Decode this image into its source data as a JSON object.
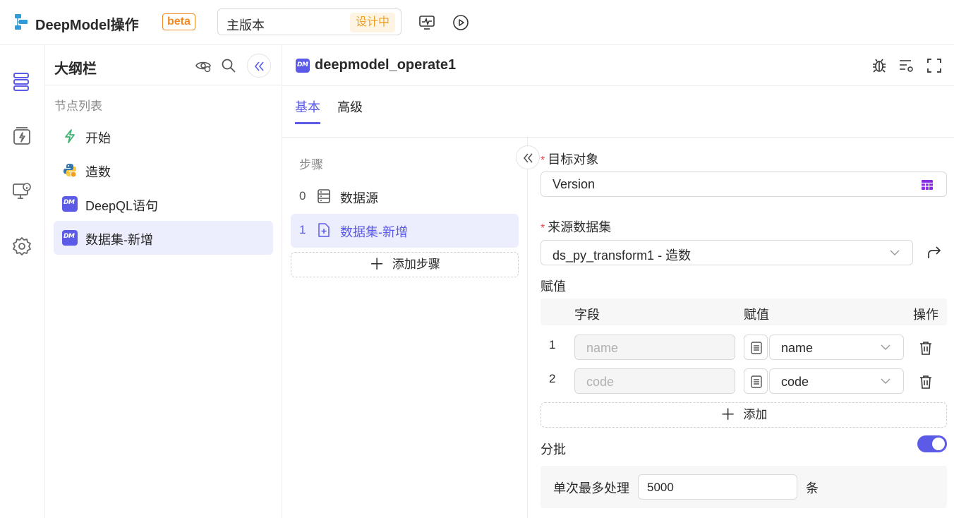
{
  "app": {
    "title": "DeepModel操作",
    "badge": "beta"
  },
  "version": {
    "name": "主版本",
    "status": "设计中"
  },
  "outline": {
    "title": "大纲栏",
    "section_label": "节点列表",
    "nodes": [
      {
        "label": "开始",
        "icon": "lightning-icon"
      },
      {
        "label": "造数",
        "icon": "python-icon"
      },
      {
        "label": "DeepQL语句",
        "icon": "dm-icon"
      },
      {
        "label": "数据集-新增",
        "icon": "dm-icon",
        "active": true
      }
    ]
  },
  "main": {
    "badge": "DM",
    "title": "deepmodel_operate1",
    "tabs": [
      {
        "label": "基本",
        "active": true
      },
      {
        "label": "高级",
        "active": false
      }
    ]
  },
  "steps": {
    "label": "步骤",
    "items": [
      {
        "num": "0",
        "label": "数据源",
        "icon": "database-icon"
      },
      {
        "num": "1",
        "label": "数据集-新增",
        "icon": "file-add-icon",
        "active": true
      }
    ],
    "add_label": "添加步骤"
  },
  "form": {
    "target": {
      "label": "目标对象",
      "value": "Version"
    },
    "source": {
      "label": "来源数据集",
      "value": "ds_py_transform1 - 造数"
    },
    "assign": {
      "label": "赋值",
      "headers": {
        "field": "字段",
        "value": "赋值",
        "action": "操作"
      },
      "rows": [
        {
          "num": "1",
          "field": "name",
          "value": "name"
        },
        {
          "num": "2",
          "field": "code",
          "value": "code"
        }
      ],
      "add_label": "添加"
    },
    "batch": {
      "label": "分批",
      "enabled": true,
      "max_label": "单次最多处理",
      "max_value": "5000",
      "unit": "条"
    }
  },
  "colors": {
    "accent": "#5b5be8",
    "warning": "#f08a24",
    "required": "#e5484d",
    "active_bg": "#eceefd"
  }
}
